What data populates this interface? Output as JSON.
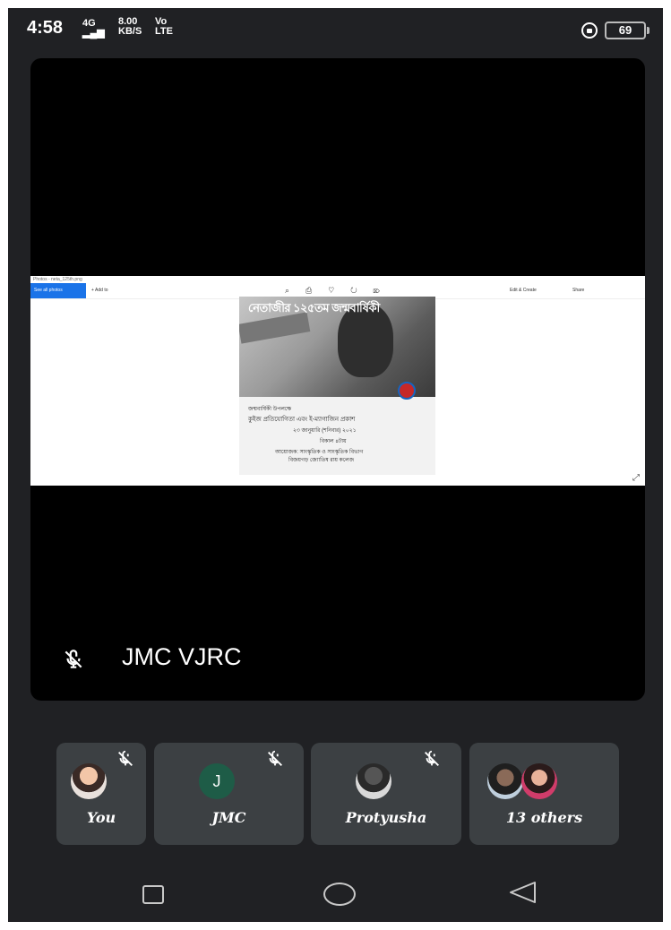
{
  "status_bar": {
    "time": "4:58",
    "network": "4G",
    "speed_value": "8.00",
    "speed_unit": "KB/S",
    "lte_top": "Vo",
    "lte_bottom": "LTE",
    "battery": "69"
  },
  "presentation": {
    "window_title": "Photos - neta_125th.png",
    "see_all_label": "See all photos",
    "add_to_label": "+ Add to",
    "edit_create_label": "Edit & Create",
    "share_label": "Share",
    "poster_title": "নেতাজীর ১২৫তম জন্মবার্ষিকী",
    "poster_lines": [
      "জন্মবার্ষিকী উপলক্ষে",
      "কুইজ প্রতিযোগিতা এবং ই-ম্যাগাজিন প্রকাশ",
      "২৩ জানুয়ারি (শনিবার) ২০২১",
      "বিকাল ৪টায়",
      "আয়োজক: সাংস্কৃতিক ও সাংস্কৃতিক বিভাগ",
      "বিজয়গড় জ্যোতিষ রায় কলেজ"
    ]
  },
  "speaker": {
    "name": "JMC VJRC"
  },
  "participants": [
    {
      "name": "You"
    },
    {
      "name": "JMC",
      "initial": "J"
    },
    {
      "name": "Protyusha"
    },
    {
      "name": "13 others"
    }
  ]
}
